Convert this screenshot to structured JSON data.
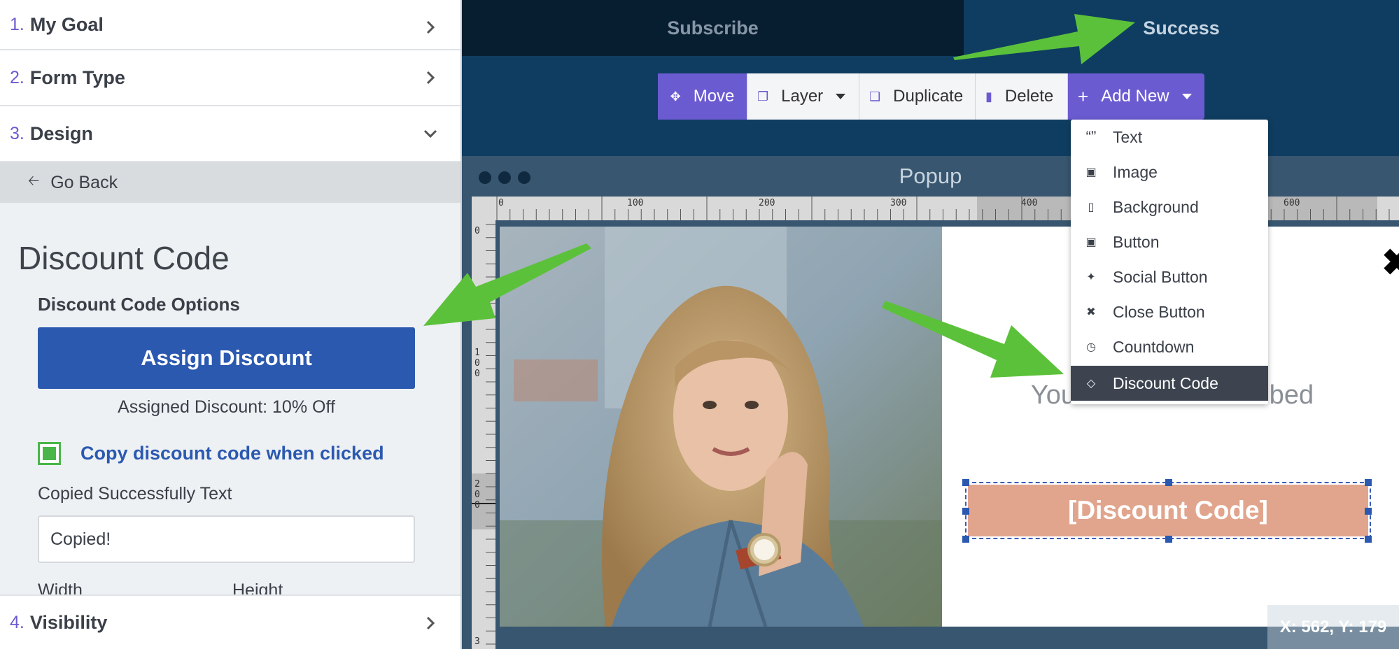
{
  "steps": [
    {
      "num": "1.",
      "label": "My Goal"
    },
    {
      "num": "2.",
      "label": "Form Type"
    },
    {
      "num": "3.",
      "label": "Design"
    },
    {
      "num": "4.",
      "label": "Visibility"
    }
  ],
  "go_back": "Go Back",
  "design": {
    "title": "Discount Code",
    "options_heading": "Discount Code Options",
    "assign_button": "Assign Discount",
    "assigned_text": "Assigned Discount: 10% Off",
    "copy_checkbox_label": "Copy discount code when clicked",
    "copy_checked": true,
    "copied_text_label": "Copied Successfully Text",
    "copied_text_value": "Copied!",
    "width_label": "Width",
    "height_label": "Height"
  },
  "tabs": {
    "subscribe": "Subscribe",
    "success": "Success"
  },
  "toolbar": {
    "move": "Move",
    "layer": "Layer",
    "duplicate": "Duplicate",
    "delete": "Delete",
    "add_new": "Add New"
  },
  "add_new_menu": [
    {
      "label": "Text",
      "icon": "quote-icon"
    },
    {
      "label": "Image",
      "icon": "image-icon"
    },
    {
      "label": "Background",
      "icon": "page-icon"
    },
    {
      "label": "Button",
      "icon": "image-icon"
    },
    {
      "label": "Social Button",
      "icon": "twitter-icon"
    },
    {
      "label": "Close Button",
      "icon": "close-icon"
    },
    {
      "label": "Countdown",
      "icon": "clock-icon"
    },
    {
      "label": "Discount Code",
      "icon": "tag-icon",
      "selected": true
    }
  ],
  "popup": {
    "window_title": "Popup",
    "subscribed_text": "You are now subscribed",
    "discount_button": "[Discount Code]",
    "coords": "X: 562, Y: 179"
  },
  "ruler": {
    "top_ticks": [
      "0",
      "100",
      "200",
      "300",
      "400",
      "600"
    ],
    "left_ticks": [
      "0",
      "100",
      "200",
      "3"
    ]
  },
  "colors": {
    "accent_purple": "#6b5bd1",
    "assign_blue": "#2b59b0",
    "checkbox_green": "#4ab64a",
    "editor_bg": "#0f3d61",
    "discount_button_bg": "#e1a58d",
    "arrow_green": "#5cc13a"
  }
}
